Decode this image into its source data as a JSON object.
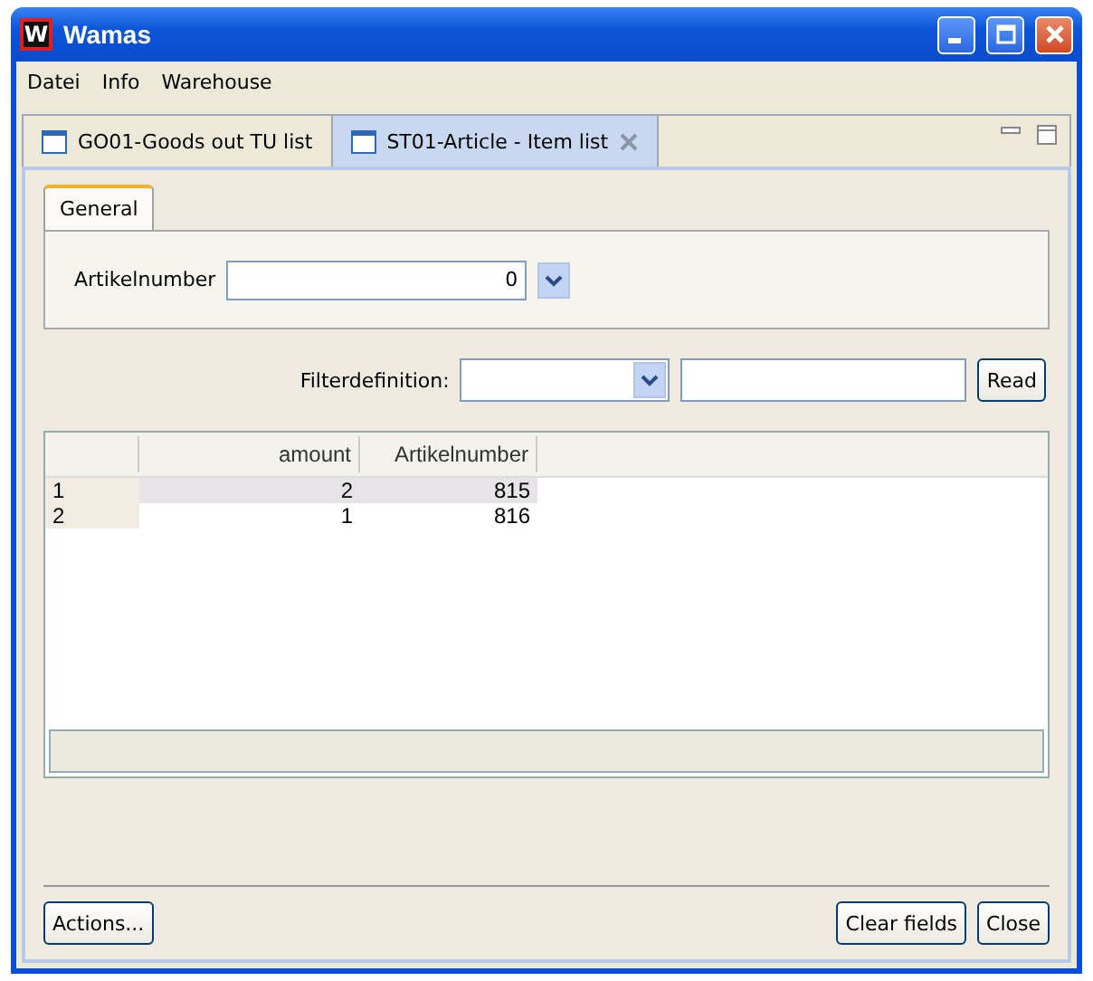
{
  "window": {
    "title": "Wamas",
    "app_icon": "W"
  },
  "menu": [
    "Datei",
    "Info",
    "Warehouse"
  ],
  "editor_tabs": [
    {
      "label": "GO01-Goods out TU list",
      "selected": false,
      "closable": false
    },
    {
      "label": "ST01-Article - Item list",
      "selected": true,
      "closable": true
    }
  ],
  "form_tabs": [
    {
      "label": "General",
      "selected": true
    }
  ],
  "artikelnumber": {
    "label": "Artikelnumber",
    "value": "0"
  },
  "filter": {
    "label": "Filterdefinition:",
    "read_button": "Read"
  },
  "table": {
    "columns": [
      "amount",
      "Artikelnumber"
    ],
    "rows": [
      {
        "index": "1",
        "amount": "2",
        "artikelnumber": "815",
        "selected": true
      },
      {
        "index": "2",
        "amount": "1",
        "artikelnumber": "816",
        "selected": false
      }
    ]
  },
  "buttons": {
    "actions": "Actions...",
    "clear": "Clear fields",
    "close": "Close"
  }
}
